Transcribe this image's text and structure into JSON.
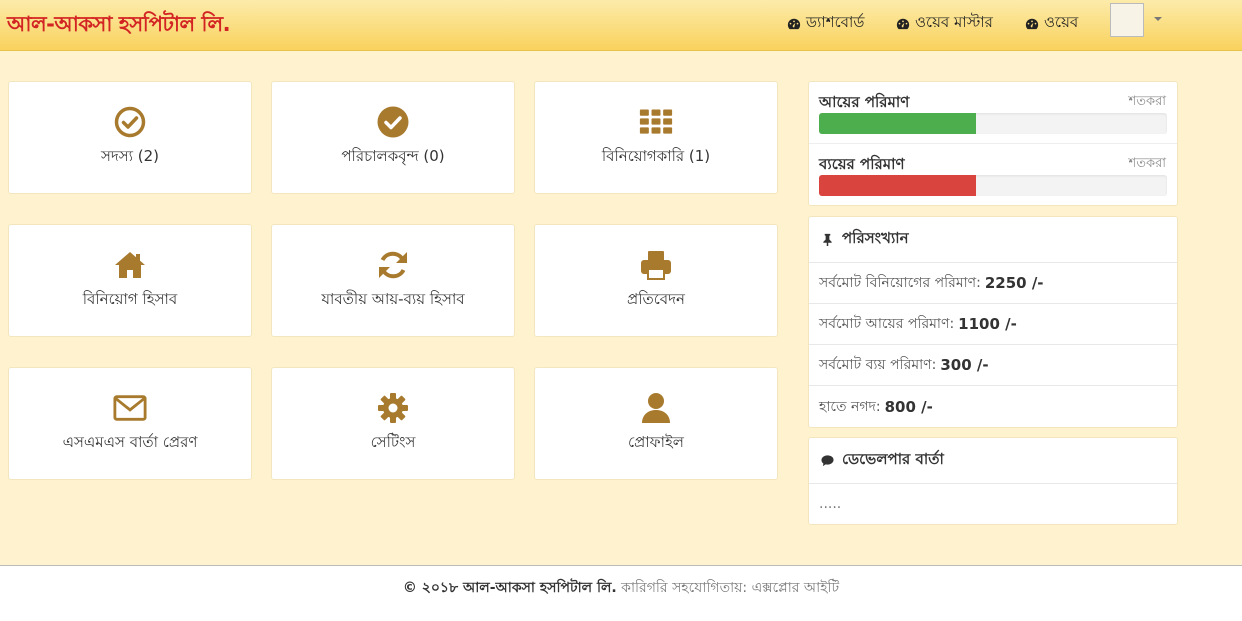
{
  "header": {
    "brand": "আল-আকসা হসপিটাল লি.",
    "nav": [
      {
        "label": "ড্যাশবোর্ড",
        "icon": "dashboard-icon"
      },
      {
        "label": "ওয়েব মাস্টার",
        "icon": "dashboard-icon"
      },
      {
        "label": "ওয়েব",
        "icon": "dashboard-icon"
      }
    ]
  },
  "tiles": [
    {
      "label": "সদস্য (2)",
      "icon": "check-circle-icon"
    },
    {
      "label": "পরিচালকবৃন্দ (0)",
      "icon": "check-circle-filled-icon"
    },
    {
      "label": "বিনিয়োগকারি (1)",
      "icon": "grid-icon"
    },
    {
      "label": "বিনিয়োগ হিসাব",
      "icon": "home-icon"
    },
    {
      "label": "যাবতীয় আয়-ব্যয় হিসাব",
      "icon": "refresh-icon"
    },
    {
      "label": "প্রতিবেদন",
      "icon": "print-icon"
    },
    {
      "label": "এসএমএস বার্তা প্রেরণ",
      "icon": "envelope-icon"
    },
    {
      "label": "সেটিংস",
      "icon": "gear-icon"
    },
    {
      "label": "প্রোফাইল",
      "icon": "user-icon"
    }
  ],
  "progress": [
    {
      "title": "আয়ের পরিমাণ",
      "unit": "শতকরা",
      "fraction": 0.45,
      "color": "#4cae4c"
    },
    {
      "title": "ব্যয়ের পরিমাণ",
      "unit": "শতকরা",
      "fraction": 0.45,
      "color": "#d9443f"
    }
  ],
  "stats": {
    "title": "পরিসংখ্যান",
    "rows": [
      {
        "label": "সর্বমোট বিনিয়োগের পরিমাণ:",
        "value": "2250 /-"
      },
      {
        "label": "সর্বমোট আয়ের পরিমাণ:",
        "value": "1100 /-"
      },
      {
        "label": "সর্বমোট ব্যয় পরিমাণ:",
        "value": "300 /-"
      },
      {
        "label": "হাতে নগদ:",
        "value": "800 /-"
      }
    ]
  },
  "developer": {
    "title": "ডেভেলপার বার্তা",
    "body": "....."
  },
  "footer": {
    "copyright": "© ২০১৮ আল-আকসা হসপিটাল লি.",
    "credit": "কারিগরি সহযোগিতায়: এক্সপ্লোর আইটি"
  },
  "colors": {
    "icon": "#a87a2e",
    "brand": "#d32424",
    "content_bg": "#fff3cf"
  }
}
